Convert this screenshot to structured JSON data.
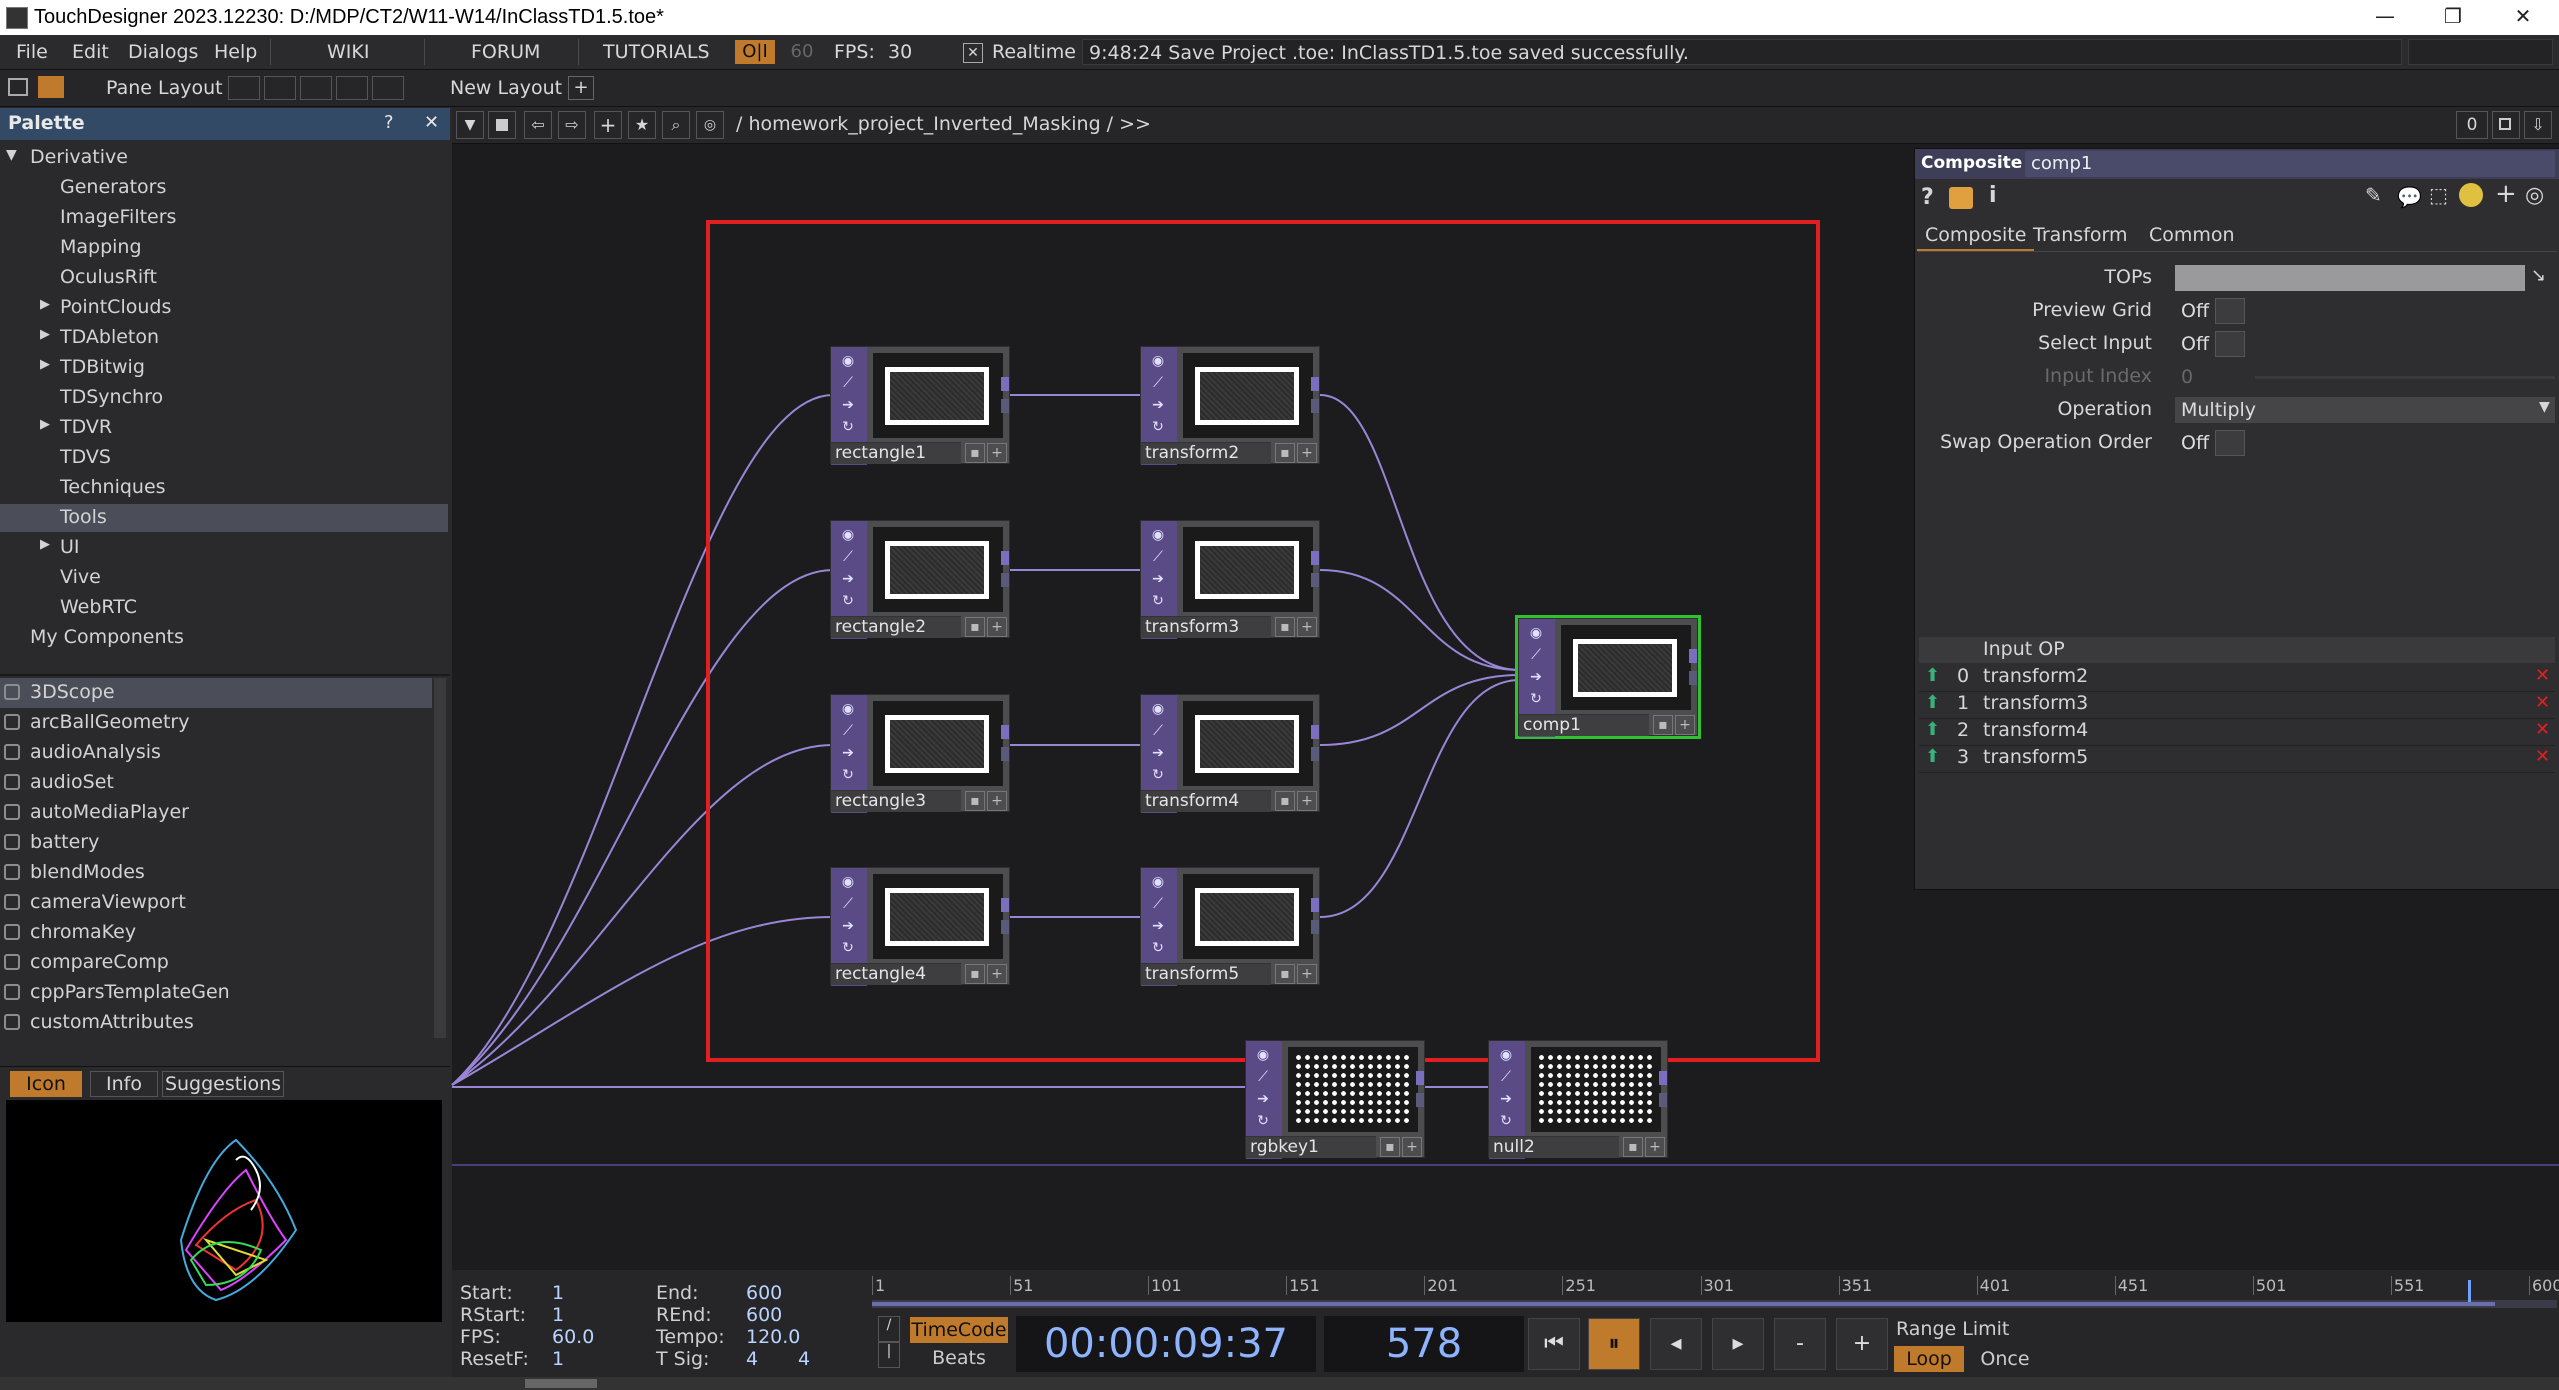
{
  "window": {
    "title": "TouchDesigner 2023.12230: D:/MDP/CT2/W11-W14/InClassTD1.5.toe*",
    "minimize": "—",
    "maximize": "❐",
    "close": "✕"
  },
  "menu": {
    "items": [
      "File",
      "Edit",
      "Dialogs",
      "Help"
    ],
    "wiki": "WIKI",
    "forum": "FORUM",
    "tutorials": "TUTORIALS",
    "oi": "O|I",
    "fps_target": "60",
    "fps_label": "FPS:",
    "fps_value": "30",
    "realtime_check": "✕",
    "realtime_label": "Realtime",
    "status": "9:48:24 Save Project .toe: InClassTD1.5.toe saved successfully."
  },
  "layout_bar": {
    "pane_layout": "Pane Layout",
    "new_layout": "New Layout",
    "add": "+"
  },
  "palette": {
    "title": "Palette",
    "help": "?",
    "close": "✕",
    "root": "Derivative",
    "tree": [
      {
        "label": "Generators",
        "expandable": false
      },
      {
        "label": "ImageFilters",
        "expandable": false
      },
      {
        "label": "Mapping",
        "expandable": false
      },
      {
        "label": "OculusRift",
        "expandable": false
      },
      {
        "label": "PointClouds",
        "expandable": true
      },
      {
        "label": "TDAbleton",
        "expandable": true
      },
      {
        "label": "TDBitwig",
        "expandable": true
      },
      {
        "label": "TDSynchro",
        "expandable": false
      },
      {
        "label": "TDVR",
        "expandable": true
      },
      {
        "label": "TDVS",
        "expandable": false
      },
      {
        "label": "Techniques",
        "expandable": false
      },
      {
        "label": "Tools",
        "expandable": false,
        "selected": true
      },
      {
        "label": "UI",
        "expandable": true
      },
      {
        "label": "Vive",
        "expandable": false
      },
      {
        "label": "WebRTC",
        "expandable": false
      }
    ],
    "my_components": "My Components",
    "components": [
      "3DScope",
      "arcBallGeometry",
      "audioAnalysis",
      "audioSet",
      "autoMediaPlayer",
      "battery",
      "blendModes",
      "cameraViewport",
      "chromaKey",
      "compareComp",
      "cppParsTemplateGen",
      "customAttributes"
    ],
    "tabs": [
      "Icon",
      "Info",
      "Suggestions"
    ]
  },
  "network": {
    "path": "/ homework_project_Inverted_Masking / >>",
    "counter": "0",
    "nodes": {
      "rectangle1": "rectangle1",
      "rectangle2": "rectangle2",
      "rectangle3": "rectangle3",
      "rectangle4": "rectangle4",
      "transform2": "transform2",
      "transform3": "transform3",
      "transform4": "transform4",
      "transform5": "transform5",
      "comp1": "comp1",
      "rgbkey1": "rgbkey1",
      "null2": "null2"
    }
  },
  "params": {
    "op_type": "Composite",
    "op_name": "comp1",
    "tabs": [
      "Composite",
      "Transform",
      "Common"
    ],
    "rows": [
      {
        "label": "TOPs",
        "value": ""
      },
      {
        "label": "Preview Grid",
        "value": "Off"
      },
      {
        "label": "Select Input",
        "value": "Off"
      },
      {
        "label": "Input Index",
        "value": "0"
      },
      {
        "label": "Operation",
        "value": "Multiply"
      },
      {
        "label": "Swap Operation Order",
        "value": "Off"
      }
    ],
    "seq_header": "Input OP",
    "inputs": [
      {
        "index": "0",
        "op": "transform2"
      },
      {
        "index": "1",
        "op": "transform3"
      },
      {
        "index": "2",
        "op": "transform4"
      },
      {
        "index": "3",
        "op": "transform5"
      }
    ]
  },
  "timeline": {
    "start_label": "Start:",
    "start": "1",
    "end_label": "End:",
    "end": "600",
    "rstart_label": "RStart:",
    "rstart": "1",
    "rend_label": "REnd:",
    "rend": "600",
    "fps_label": "FPS:",
    "fps": "60.0",
    "tempo_label": "Tempo:",
    "tempo": "120.0",
    "resetf_label": "ResetF:",
    "resetf": "1",
    "tsig_label": "T Sig:",
    "tsig_a": "4",
    "tsig_b": "4",
    "ticks": [
      "1",
      "51",
      "101",
      "151",
      "201",
      "251",
      "301",
      "351",
      "401",
      "451",
      "501",
      "551",
      "600"
    ],
    "timecode_tab": "TimeCode",
    "beats_tab": "Beats",
    "timecode": "00:00:09:37",
    "frame": "578",
    "range_limit": "Range Limit",
    "loop": "Loop",
    "once": "Once",
    "current_frame_fraction": 0.963
  }
}
